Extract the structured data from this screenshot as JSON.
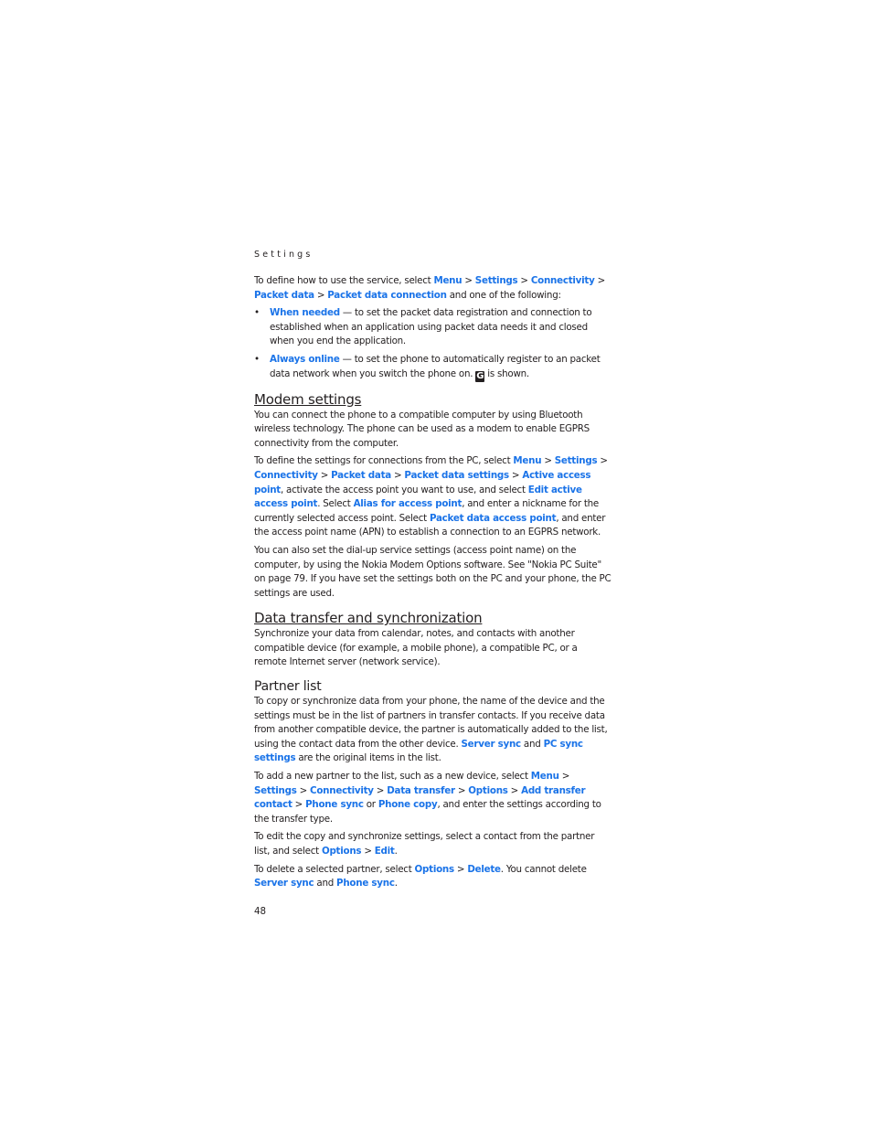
{
  "running_head": "Settings",
  "intro": {
    "t1": "To define how to use the service, select ",
    "menu": "Menu",
    "sep": " > ",
    "settings": "Settings",
    "connectivity": "Connectivity",
    "packet_data": "Packet data",
    "packet_data_connection": "Packet data connection",
    "t2": " and one of the following:"
  },
  "bullets": [
    {
      "label": "When needed",
      "text": " — to set the packet data registration and connection to established when an application using packet data needs it and closed when you end the application."
    },
    {
      "label": "Always online",
      "text": " — to set the phone to automatically register to an packet data network when you switch the phone on. ",
      "icon": "G",
      "text2": " is shown."
    }
  ],
  "modem": {
    "heading": "Modem settings",
    "p1": "You can connect the phone to a compatible computer by using Bluetooth wireless technology. The phone can be used as a modem to enable EGPRS connectivity from the computer.",
    "p2_t1": "To define the settings for connections from the PC, select ",
    "menu": "Menu",
    "settings": "Settings",
    "connectivity": "Connectivity",
    "packet_data": "Packet data",
    "packet_data_settings": "Packet data settings",
    "active_access_point": "Active access point",
    "p2_t2": ", activate the access point you want to use, and select ",
    "edit_active_access_point": "Edit active access point",
    "p2_t3": ". Select ",
    "alias": "Alias for access point",
    "p2_t4": ", and enter a nickname for the currently selected access point. Select ",
    "packet_data_access_point": "Packet data access point",
    "p2_t5": ", and enter the access point name (APN) to establish a connection to an EGPRS network.",
    "p3": "You can also set the dial-up service settings (access point name) on the computer, by using the Nokia Modem Options software. See \"Nokia PC Suite\" on page 79. If you have set the settings both on the PC and your phone, the PC settings are used."
  },
  "sync": {
    "heading": "Data transfer and synchronization",
    "p1": "Synchronize your data from calendar, notes, and contacts with another compatible device (for example, a mobile phone), a compatible PC, or a remote Internet server (network service).",
    "partner_heading": "Partner list",
    "p2_t1": "To copy or synchronize data from your phone, the name of the device and the settings must be in the list of partners in transfer contacts. If you receive data from another compatible device, the partner is automatically added to the list, using the contact data from the other device. ",
    "server_sync": "Server sync",
    "and": " and ",
    "pc_sync_settings": "PC sync settings",
    "p2_t2": " are the original items in the list.",
    "p3_t1": "To add a new partner to the list, such as a new device, select ",
    "menu": "Menu",
    "settings": "Settings",
    "connectivity": "Connectivity",
    "data_transfer": "Data transfer",
    "options": "Options",
    "add_transfer_contact": "Add transfer contact",
    "phone_sync": "Phone sync",
    "or": " or ",
    "phone_copy": "Phone copy",
    "p3_t2": ", and enter the settings according to the transfer type.",
    "p4_t1": "To edit the copy and synchronize settings, select a contact from the partner list, and select ",
    "edit": "Edit",
    "period": ".",
    "p5_t1": "To delete a selected partner, select ",
    "delete": "Delete",
    "p5_t2": ". You cannot delete ",
    "server": "Server sync"
  },
  "page_number": "48"
}
